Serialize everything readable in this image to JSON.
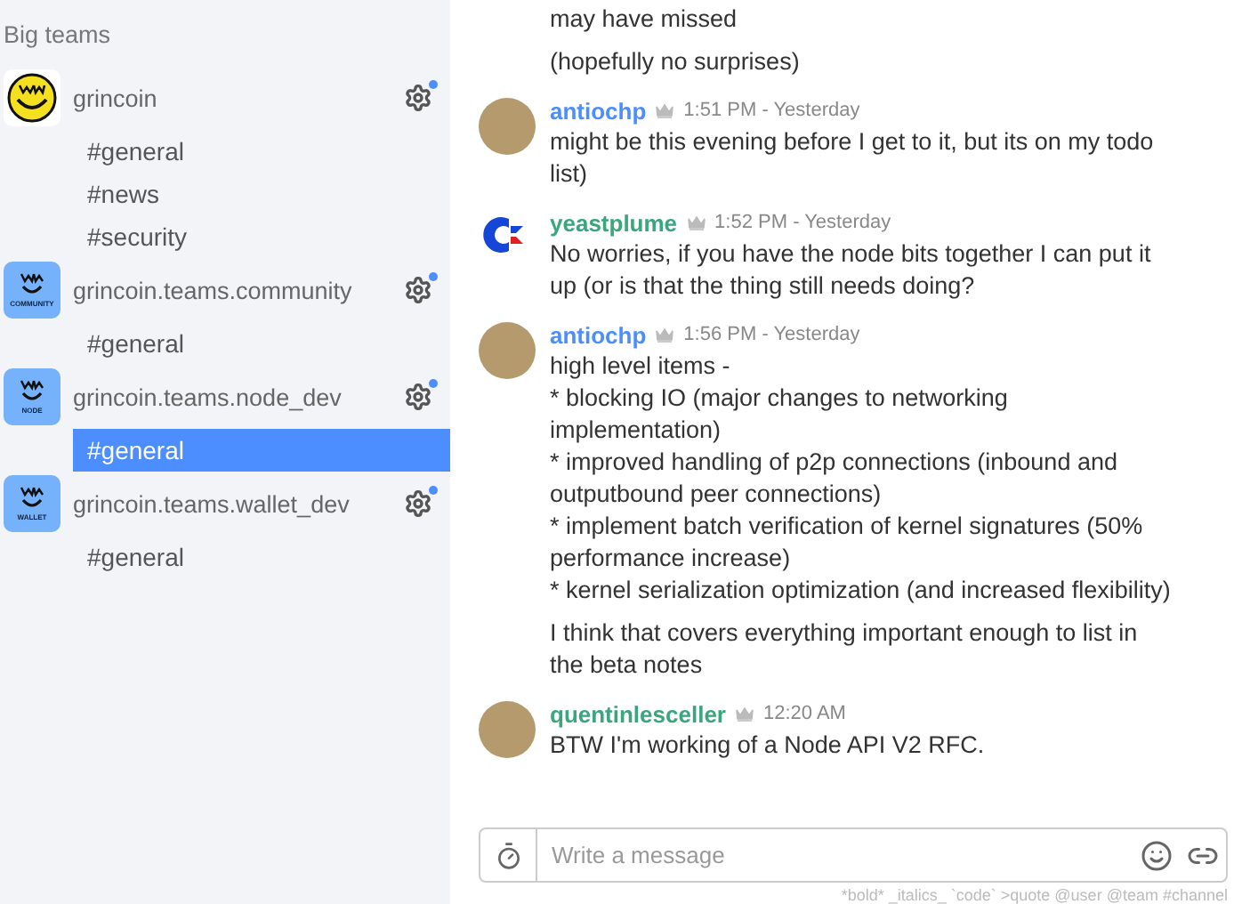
{
  "sidebar": {
    "heading": "Big teams",
    "teams": [
      {
        "name": "grincoin",
        "avatar": {
          "kind": "logo"
        },
        "channels": [
          {
            "name": "#general",
            "selected": false
          },
          {
            "name": "#news",
            "selected": false
          },
          {
            "name": "#security",
            "selected": false
          }
        ]
      },
      {
        "name": "grincoin.teams.community",
        "avatar": {
          "kind": "badge",
          "label": "COMMUNITY"
        },
        "channels": [
          {
            "name": "#general",
            "selected": false
          }
        ]
      },
      {
        "name": "grincoin.teams.node_dev",
        "avatar": {
          "kind": "badge",
          "label": "NODE"
        },
        "channels": [
          {
            "name": "#general",
            "selected": true
          }
        ]
      },
      {
        "name": "grincoin.teams.wallet_dev",
        "avatar": {
          "kind": "badge",
          "label": "WALLET"
        },
        "channels": [
          {
            "name": "#general",
            "selected": false
          }
        ]
      }
    ]
  },
  "messages": [
    {
      "kind": "continuation",
      "paragraphs": [
        "may have missed",
        "(hopefully no surprises)"
      ]
    },
    {
      "kind": "message",
      "author": "antiochp",
      "color": "#4c8eff",
      "avatar": {
        "kind": "photo"
      },
      "time": "1:51 PM - Yesterday",
      "paragraphs": [
        "might be this evening before I get to it, but its on my todo list)"
      ]
    },
    {
      "kind": "message",
      "author": "yeastplume",
      "color": "#3aa67e",
      "avatar": {
        "kind": "logo"
      },
      "time": "1:52 PM - Yesterday",
      "paragraphs": [
        "No worries, if you have the node bits together I can put it up (or is that the thing still needs doing?"
      ]
    },
    {
      "kind": "message",
      "author": "antiochp",
      "color": "#4c8eff",
      "avatar": {
        "kind": "photo"
      },
      "time": "1:56 PM - Yesterday",
      "paragraphs": [
        "high level items -\n* blocking IO (major changes to networking implementation)\n* improved handling of p2p connections (inbound and outputbound peer connections)\n* implement batch verification of kernel signatures (50% performance increase)\n* kernel serialization optimization (and increased flexibility)",
        "I think that covers everything important enough to list in the beta notes"
      ]
    },
    {
      "kind": "message",
      "author": "quentinlesceller",
      "color": "#3aa67e",
      "avatar": {
        "kind": "photo"
      },
      "time": "12:20 AM",
      "paragraphs": [
        "BTW I'm working of a Node API V2 RFC."
      ]
    }
  ],
  "composer": {
    "placeholder": "Write a message",
    "hint": "*bold*   _italics_   `code`   >quote   @user   @team   #channel"
  }
}
